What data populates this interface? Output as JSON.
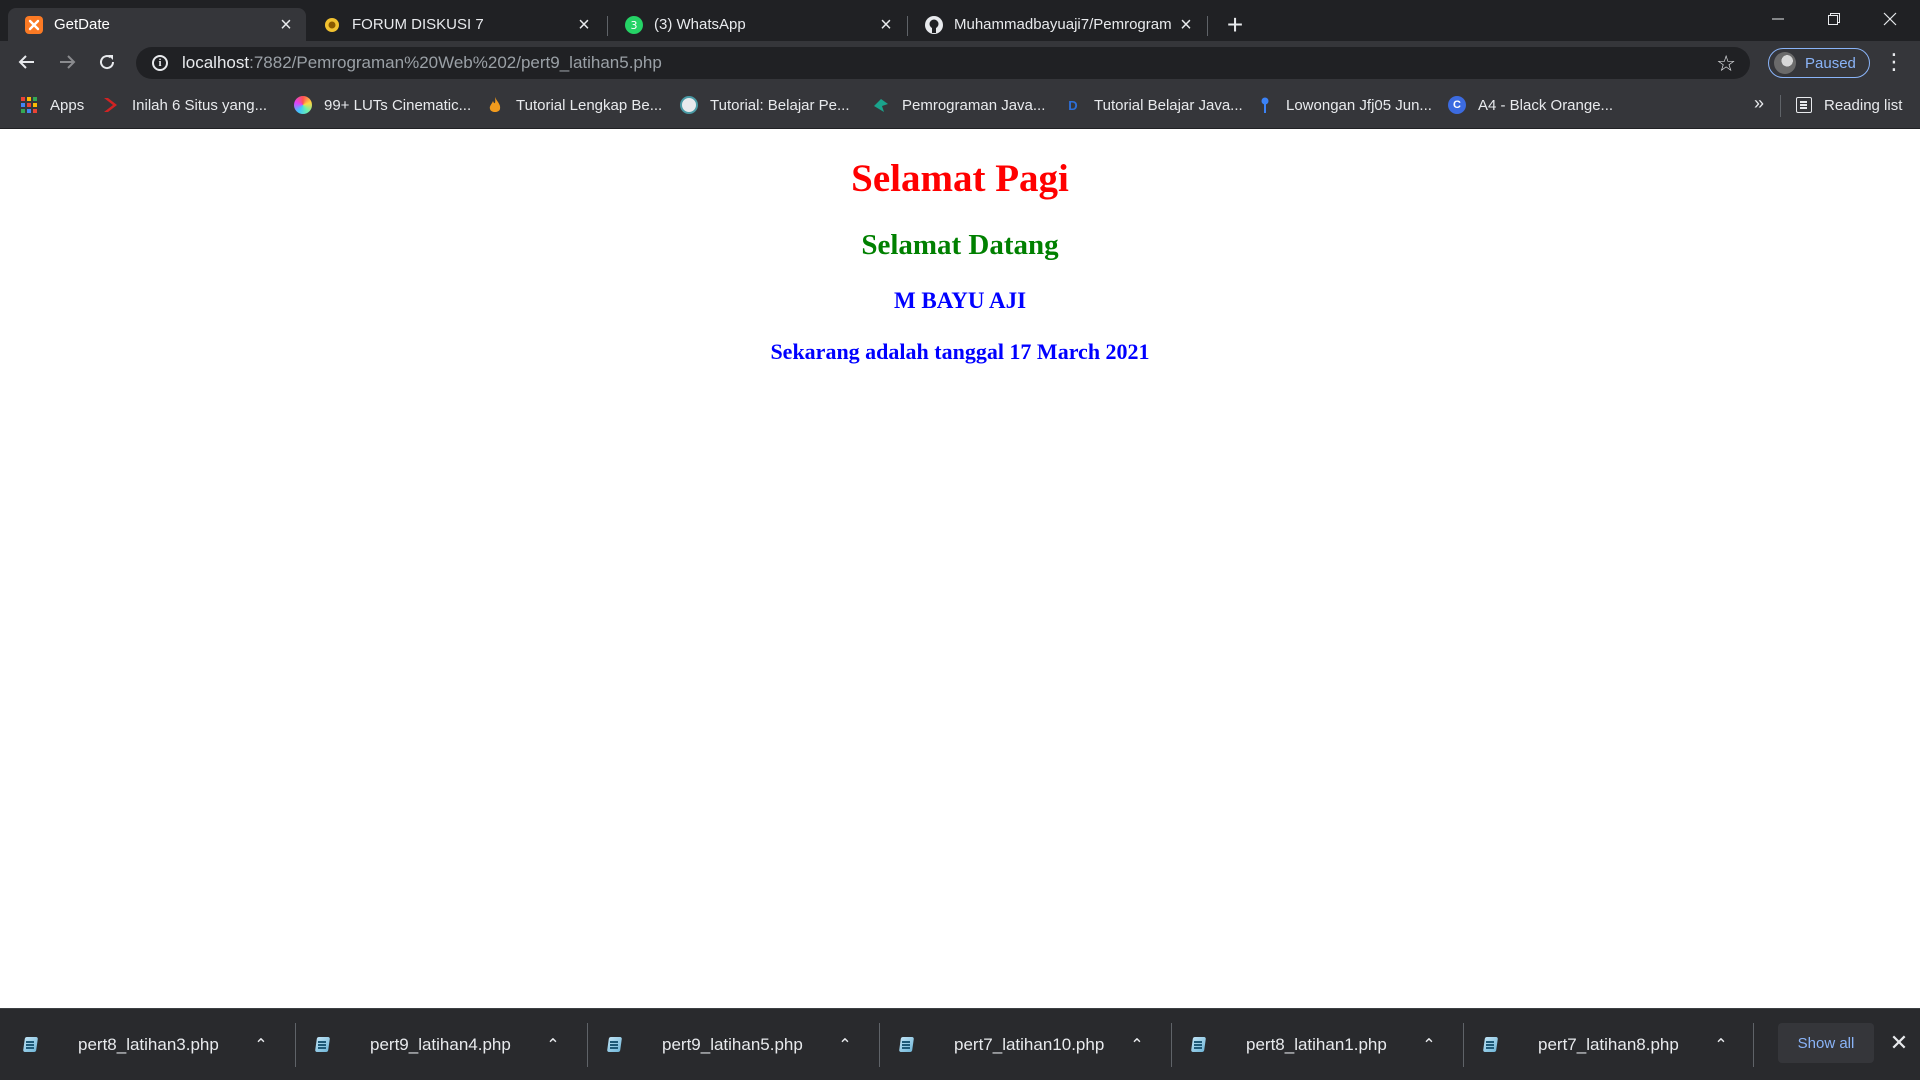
{
  "tabs": [
    {
      "title": "GetDate",
      "icon": "xampp-icon",
      "active": true
    },
    {
      "title": "FORUM DISKUSI 7",
      "icon": "forum-icon",
      "active": false
    },
    {
      "title": "(3) WhatsApp",
      "icon": "whatsapp-icon",
      "badge": "3",
      "active": false
    },
    {
      "title": "Muhammadbayuaji7/Pemrogram",
      "icon": "github-icon",
      "active": false
    }
  ],
  "toolbar": {
    "url_host": "localhost",
    "url_path": ":7882/Pemrograman%20Web%202/pert9_latihan5.php",
    "profile_label": "Paused"
  },
  "bookmarks": {
    "items": [
      {
        "label": "Apps",
        "icon": "apps-grid-icon"
      },
      {
        "label": "Inilah 6 Situs yang...",
        "icon": "red-chevron-icon"
      },
      {
        "label": "99+ LUTs Cinematic...",
        "icon": "color-wheel-icon"
      },
      {
        "label": "Tutorial Lengkap Be...",
        "icon": "flame-icon"
      },
      {
        "label": "Tutorial: Belajar Pe...",
        "icon": "teal-globe-icon"
      },
      {
        "label": "Pemrograman Java...",
        "icon": "green-bird-icon"
      },
      {
        "label": "Tutorial Belajar Java...",
        "icon": "d-letter-icon",
        "glyph": "D"
      },
      {
        "label": "Lowongan Jfj05 Jun...",
        "icon": "blue-pin-icon"
      },
      {
        "label": "A4 - Black Orange...",
        "icon": "canva-icon",
        "glyph": "C"
      }
    ],
    "reading_list": "Reading list"
  },
  "page": {
    "greeting": "Selamat Pagi",
    "welcome": "Selamat Datang",
    "name": "M BAYU AJI",
    "date_line": "Sekarang adalah tanggal 17 March 2021"
  },
  "downloads": {
    "items": [
      {
        "name": "pert8_latihan3.php"
      },
      {
        "name": "pert9_latihan4.php"
      },
      {
        "name": "pert9_latihan5.php"
      },
      {
        "name": "pert7_latihan10.php"
      },
      {
        "name": "pert8_latihan1.php"
      },
      {
        "name": "pert7_latihan8.php"
      }
    ],
    "show_all": "Show all"
  },
  "colors": {
    "greeting": "#ff0000",
    "welcome": "#008000",
    "name": "#0000ff",
    "accent": "#8ab4f8"
  }
}
